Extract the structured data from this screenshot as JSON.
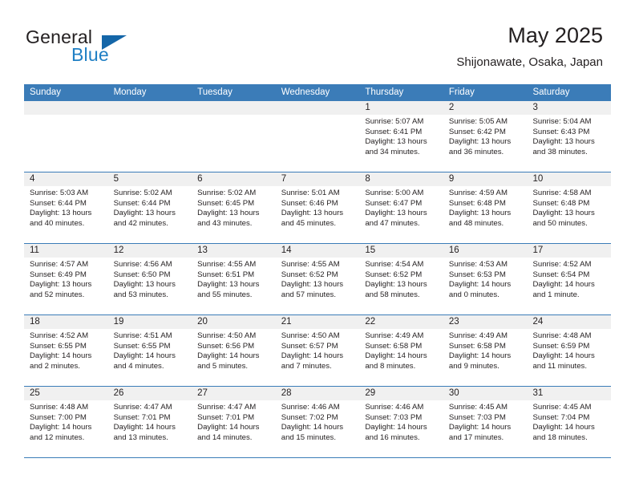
{
  "brand": {
    "name_top": "General",
    "name_bottom": "Blue",
    "accent_color": "#1f7fc4",
    "triangle_color": "#1466a8"
  },
  "header": {
    "title": "May 2025",
    "location": "Shijonawate, Osaka, Japan"
  },
  "theme": {
    "header_bar_color": "#3b7cb8",
    "daynum_band_color": "#f0f0f0",
    "text_color": "#231f20"
  },
  "weekdays": [
    "Sunday",
    "Monday",
    "Tuesday",
    "Wednesday",
    "Thursday",
    "Friday",
    "Saturday"
  ],
  "weeks": [
    [
      {
        "day": "",
        "sunrise": "",
        "sunset": "",
        "daylight": "",
        "empty": true
      },
      {
        "day": "",
        "sunrise": "",
        "sunset": "",
        "daylight": "",
        "empty": true
      },
      {
        "day": "",
        "sunrise": "",
        "sunset": "",
        "daylight": "",
        "empty": true
      },
      {
        "day": "",
        "sunrise": "",
        "sunset": "",
        "daylight": "",
        "empty": true
      },
      {
        "day": "1",
        "sunrise": "Sunrise: 5:07 AM",
        "sunset": "Sunset: 6:41 PM",
        "daylight": "Daylight: 13 hours and 34 minutes."
      },
      {
        "day": "2",
        "sunrise": "Sunrise: 5:05 AM",
        "sunset": "Sunset: 6:42 PM",
        "daylight": "Daylight: 13 hours and 36 minutes."
      },
      {
        "day": "3",
        "sunrise": "Sunrise: 5:04 AM",
        "sunset": "Sunset: 6:43 PM",
        "daylight": "Daylight: 13 hours and 38 minutes."
      }
    ],
    [
      {
        "day": "4",
        "sunrise": "Sunrise: 5:03 AM",
        "sunset": "Sunset: 6:44 PM",
        "daylight": "Daylight: 13 hours and 40 minutes."
      },
      {
        "day": "5",
        "sunrise": "Sunrise: 5:02 AM",
        "sunset": "Sunset: 6:44 PM",
        "daylight": "Daylight: 13 hours and 42 minutes."
      },
      {
        "day": "6",
        "sunrise": "Sunrise: 5:02 AM",
        "sunset": "Sunset: 6:45 PM",
        "daylight": "Daylight: 13 hours and 43 minutes."
      },
      {
        "day": "7",
        "sunrise": "Sunrise: 5:01 AM",
        "sunset": "Sunset: 6:46 PM",
        "daylight": "Daylight: 13 hours and 45 minutes."
      },
      {
        "day": "8",
        "sunrise": "Sunrise: 5:00 AM",
        "sunset": "Sunset: 6:47 PM",
        "daylight": "Daylight: 13 hours and 47 minutes."
      },
      {
        "day": "9",
        "sunrise": "Sunrise: 4:59 AM",
        "sunset": "Sunset: 6:48 PM",
        "daylight": "Daylight: 13 hours and 48 minutes."
      },
      {
        "day": "10",
        "sunrise": "Sunrise: 4:58 AM",
        "sunset": "Sunset: 6:48 PM",
        "daylight": "Daylight: 13 hours and 50 minutes."
      }
    ],
    [
      {
        "day": "11",
        "sunrise": "Sunrise: 4:57 AM",
        "sunset": "Sunset: 6:49 PM",
        "daylight": "Daylight: 13 hours and 52 minutes."
      },
      {
        "day": "12",
        "sunrise": "Sunrise: 4:56 AM",
        "sunset": "Sunset: 6:50 PM",
        "daylight": "Daylight: 13 hours and 53 minutes."
      },
      {
        "day": "13",
        "sunrise": "Sunrise: 4:55 AM",
        "sunset": "Sunset: 6:51 PM",
        "daylight": "Daylight: 13 hours and 55 minutes."
      },
      {
        "day": "14",
        "sunrise": "Sunrise: 4:55 AM",
        "sunset": "Sunset: 6:52 PM",
        "daylight": "Daylight: 13 hours and 57 minutes."
      },
      {
        "day": "15",
        "sunrise": "Sunrise: 4:54 AM",
        "sunset": "Sunset: 6:52 PM",
        "daylight": "Daylight: 13 hours and 58 minutes."
      },
      {
        "day": "16",
        "sunrise": "Sunrise: 4:53 AM",
        "sunset": "Sunset: 6:53 PM",
        "daylight": "Daylight: 14 hours and 0 minutes."
      },
      {
        "day": "17",
        "sunrise": "Sunrise: 4:52 AM",
        "sunset": "Sunset: 6:54 PM",
        "daylight": "Daylight: 14 hours and 1 minute."
      }
    ],
    [
      {
        "day": "18",
        "sunrise": "Sunrise: 4:52 AM",
        "sunset": "Sunset: 6:55 PM",
        "daylight": "Daylight: 14 hours and 2 minutes."
      },
      {
        "day": "19",
        "sunrise": "Sunrise: 4:51 AM",
        "sunset": "Sunset: 6:55 PM",
        "daylight": "Daylight: 14 hours and 4 minutes."
      },
      {
        "day": "20",
        "sunrise": "Sunrise: 4:50 AM",
        "sunset": "Sunset: 6:56 PM",
        "daylight": "Daylight: 14 hours and 5 minutes."
      },
      {
        "day": "21",
        "sunrise": "Sunrise: 4:50 AM",
        "sunset": "Sunset: 6:57 PM",
        "daylight": "Daylight: 14 hours and 7 minutes."
      },
      {
        "day": "22",
        "sunrise": "Sunrise: 4:49 AM",
        "sunset": "Sunset: 6:58 PM",
        "daylight": "Daylight: 14 hours and 8 minutes."
      },
      {
        "day": "23",
        "sunrise": "Sunrise: 4:49 AM",
        "sunset": "Sunset: 6:58 PM",
        "daylight": "Daylight: 14 hours and 9 minutes."
      },
      {
        "day": "24",
        "sunrise": "Sunrise: 4:48 AM",
        "sunset": "Sunset: 6:59 PM",
        "daylight": "Daylight: 14 hours and 11 minutes."
      }
    ],
    [
      {
        "day": "25",
        "sunrise": "Sunrise: 4:48 AM",
        "sunset": "Sunset: 7:00 PM",
        "daylight": "Daylight: 14 hours and 12 minutes."
      },
      {
        "day": "26",
        "sunrise": "Sunrise: 4:47 AM",
        "sunset": "Sunset: 7:01 PM",
        "daylight": "Daylight: 14 hours and 13 minutes."
      },
      {
        "day": "27",
        "sunrise": "Sunrise: 4:47 AM",
        "sunset": "Sunset: 7:01 PM",
        "daylight": "Daylight: 14 hours and 14 minutes."
      },
      {
        "day": "28",
        "sunrise": "Sunrise: 4:46 AM",
        "sunset": "Sunset: 7:02 PM",
        "daylight": "Daylight: 14 hours and 15 minutes."
      },
      {
        "day": "29",
        "sunrise": "Sunrise: 4:46 AM",
        "sunset": "Sunset: 7:03 PM",
        "daylight": "Daylight: 14 hours and 16 minutes."
      },
      {
        "day": "30",
        "sunrise": "Sunrise: 4:45 AM",
        "sunset": "Sunset: 7:03 PM",
        "daylight": "Daylight: 14 hours and 17 minutes."
      },
      {
        "day": "31",
        "sunrise": "Sunrise: 4:45 AM",
        "sunset": "Sunset: 7:04 PM",
        "daylight": "Daylight: 14 hours and 18 minutes."
      }
    ]
  ]
}
